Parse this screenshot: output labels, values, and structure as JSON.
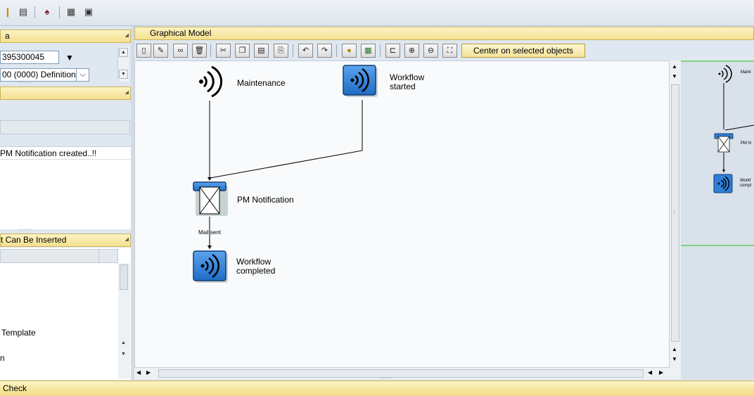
{
  "panels": {
    "left_top": {
      "header": "a",
      "workflow_id_value": "395300045",
      "version_value": "00 (0000) Definition"
    },
    "left_middle": {
      "text_row": "PM Notification created..!!"
    },
    "left_bottom": {
      "header": "t Can Be Inserted",
      "items": [
        "Template",
        "n"
      ]
    }
  },
  "graphical_model": {
    "header": "Graphical Model",
    "center_button_label": "Center on selected objects",
    "nodes": {
      "maintenance": "Maintenance",
      "workflow_started": [
        "Workflow",
        "started"
      ],
      "pm_notification": "PM Notification",
      "workflow_completed": [
        "Workflow",
        "completed"
      ]
    },
    "edge_label": "Mail sent",
    "overview": {
      "maintenance": "Maint",
      "pm_notification": "PM N",
      "workflow_completed": [
        "Workf",
        "compl"
      ]
    }
  },
  "status_bar": {
    "text": "Check"
  },
  "colors": {
    "accent_blue": "#2f7fd6",
    "header_yellow": "#f4e08f",
    "overview_line": "#22cc22"
  },
  "icons": [
    "print-icon",
    "find-icon",
    "settings-icon",
    "layout-icon",
    "help-icon"
  ]
}
